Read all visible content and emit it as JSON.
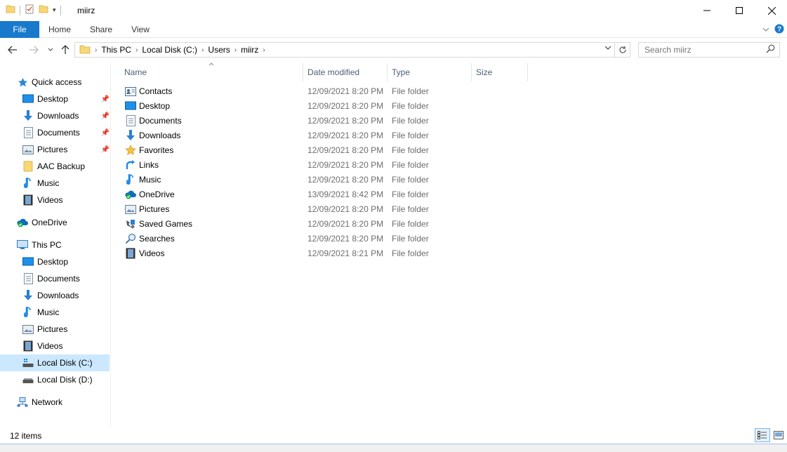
{
  "window": {
    "title": "miirz"
  },
  "ribbon": {
    "tabs": [
      "File",
      "Home",
      "Share",
      "View"
    ]
  },
  "address": {
    "crumbs": [
      "This PC",
      "Local Disk (C:)",
      "Users",
      "miirz"
    ]
  },
  "search": {
    "placeholder": "Search miirz"
  },
  "navpane": {
    "quick_access": "Quick access",
    "quick_items": [
      "Desktop",
      "Downloads",
      "Documents",
      "Pictures",
      "AAC Backup",
      "Music",
      "Videos"
    ],
    "onedrive": "OneDrive",
    "this_pc": "This PC",
    "pc_items": [
      "Desktop",
      "Documents",
      "Downloads",
      "Music",
      "Pictures",
      "Videos",
      "Local Disk (C:)",
      "Local Disk (D:)"
    ],
    "network": "Network",
    "selected": "Local Disk (C:)"
  },
  "columns": {
    "name": "Name",
    "date": "Date modified",
    "type": "Type",
    "size": "Size"
  },
  "files": [
    {
      "name": "Contacts",
      "date": "12/09/2021 8:20 PM",
      "type": "File folder",
      "icon": "contacts-icon"
    },
    {
      "name": "Desktop",
      "date": "12/09/2021 8:20 PM",
      "type": "File folder",
      "icon": "desktop-icon"
    },
    {
      "name": "Documents",
      "date": "12/09/2021 8:20 PM",
      "type": "File folder",
      "icon": "documents-icon"
    },
    {
      "name": "Downloads",
      "date": "12/09/2021 8:20 PM",
      "type": "File folder",
      "icon": "downloads-icon"
    },
    {
      "name": "Favorites",
      "date": "12/09/2021 8:20 PM",
      "type": "File folder",
      "icon": "favorites-icon"
    },
    {
      "name": "Links",
      "date": "12/09/2021 8:20 PM",
      "type": "File folder",
      "icon": "links-icon"
    },
    {
      "name": "Music",
      "date": "12/09/2021 8:20 PM",
      "type": "File folder",
      "icon": "music-icon"
    },
    {
      "name": "OneDrive",
      "date": "13/09/2021 8:42 PM",
      "type": "File folder",
      "icon": "onedrive-icon"
    },
    {
      "name": "Pictures",
      "date": "12/09/2021 8:20 PM",
      "type": "File folder",
      "icon": "pictures-icon"
    },
    {
      "name": "Saved Games",
      "date": "12/09/2021 8:20 PM",
      "type": "File folder",
      "icon": "saved-games-icon"
    },
    {
      "name": "Searches",
      "date": "12/09/2021 8:20 PM",
      "type": "File folder",
      "icon": "searches-icon"
    },
    {
      "name": "Videos",
      "date": "12/09/2021 8:21 PM",
      "type": "File folder",
      "icon": "videos-icon"
    }
  ],
  "status": {
    "count": "12 items"
  },
  "colors": {
    "accent": "#1979ca",
    "selected_bg": "#cce8ff",
    "folder_yellow": "#f8d775",
    "header_text": "#4c607a"
  }
}
